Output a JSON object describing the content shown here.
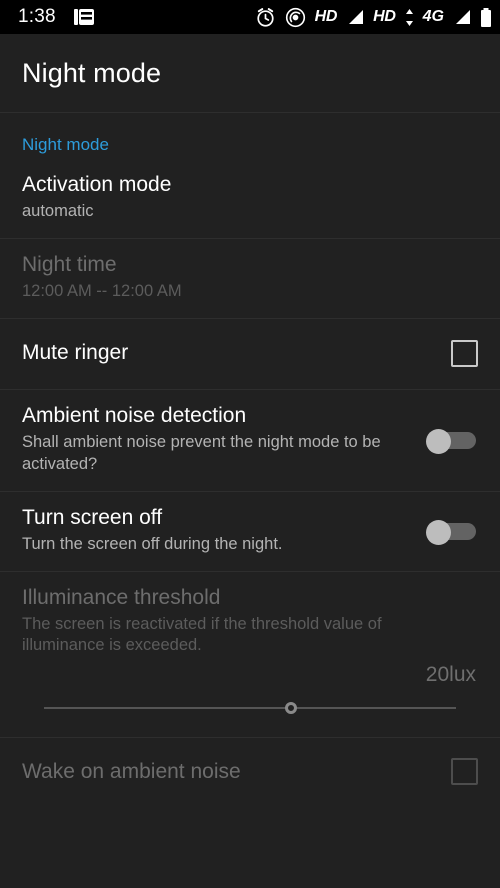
{
  "statusbar": {
    "time": "1:38",
    "left_icons": [
      "notification-list-icon"
    ],
    "right_icons": [
      "alarm-icon",
      "hotspot-icon"
    ],
    "hd_label_1": "HD",
    "hd_label_2": "HD",
    "network_label": "4G",
    "battery_icon": "battery-icon"
  },
  "appbar": {
    "title": "Night mode"
  },
  "section": {
    "header": "Night mode"
  },
  "rows": [
    {
      "title": "Activation mode",
      "summary": "automatic",
      "control": "none",
      "disabled": false
    },
    {
      "title": "Night time",
      "summary": "12:00 AM -- 12:00 AM",
      "control": "none",
      "disabled": true
    },
    {
      "title": "Mute ringer",
      "summary": "",
      "control": "checkbox",
      "checked": false,
      "disabled": false
    },
    {
      "title": "Ambient noise detection",
      "summary": "Shall ambient noise prevent the night mode to be activated?",
      "control": "toggle",
      "checked": false,
      "disabled": false
    },
    {
      "title": "Turn screen off",
      "summary": "Turn the screen off during the night.",
      "control": "toggle",
      "checked": false,
      "disabled": false
    },
    {
      "title": "Illuminance threshold",
      "summary": "The screen is reactivated if the threshold value of illuminance is exceeded.",
      "control": "slider",
      "disabled": true,
      "slider_value_label": "20lux",
      "slider_percent": 60
    },
    {
      "title": "Wake on ambient noise",
      "summary": "",
      "control": "checkbox",
      "checked": false,
      "disabled": true
    }
  ],
  "colors": {
    "background": "#212121",
    "statusbar_background": "#000000",
    "accent": "#2d9cdb",
    "title_text": "#ffffff",
    "summary_text": "#b3b3b3",
    "disabled_text": "#6d6d6d",
    "divider": "#2e2e2e"
  }
}
